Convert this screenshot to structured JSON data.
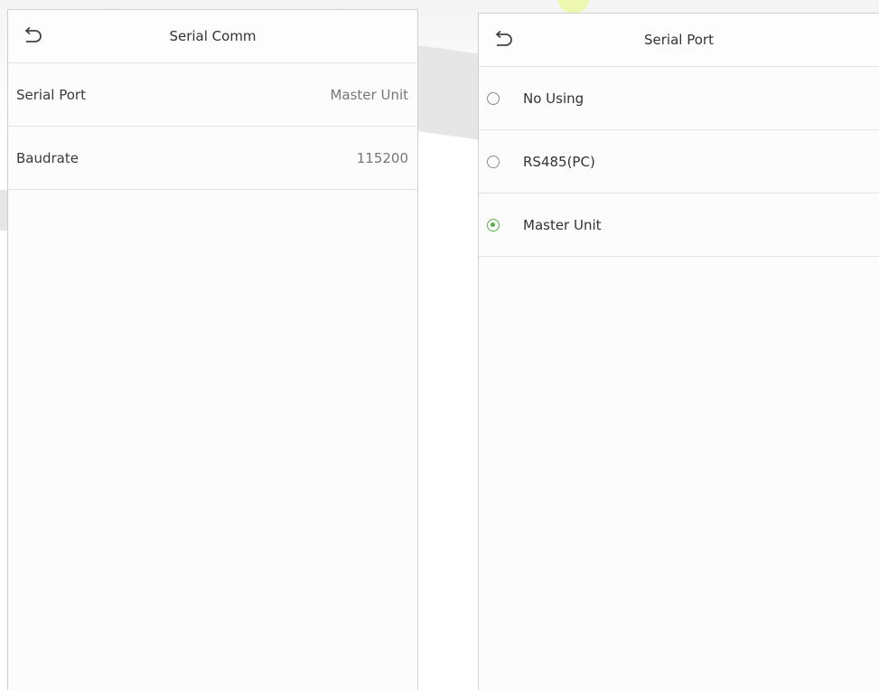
{
  "left_screen": {
    "title": "Serial Comm",
    "back_icon": "back-arrow-icon",
    "rows": [
      {
        "label": "Serial Port",
        "value": "Master Unit"
      },
      {
        "label": "Baudrate",
        "value": "115200"
      }
    ]
  },
  "right_screen": {
    "title": "Serial Port",
    "back_icon": "back-arrow-icon",
    "options": [
      {
        "label": "No Using",
        "selected": false
      },
      {
        "label": "RS485(PC)",
        "selected": false
      },
      {
        "label": "Master Unit",
        "selected": true
      }
    ]
  },
  "colors": {
    "accent": "#56b24a",
    "divider": "#e2e2e2"
  }
}
